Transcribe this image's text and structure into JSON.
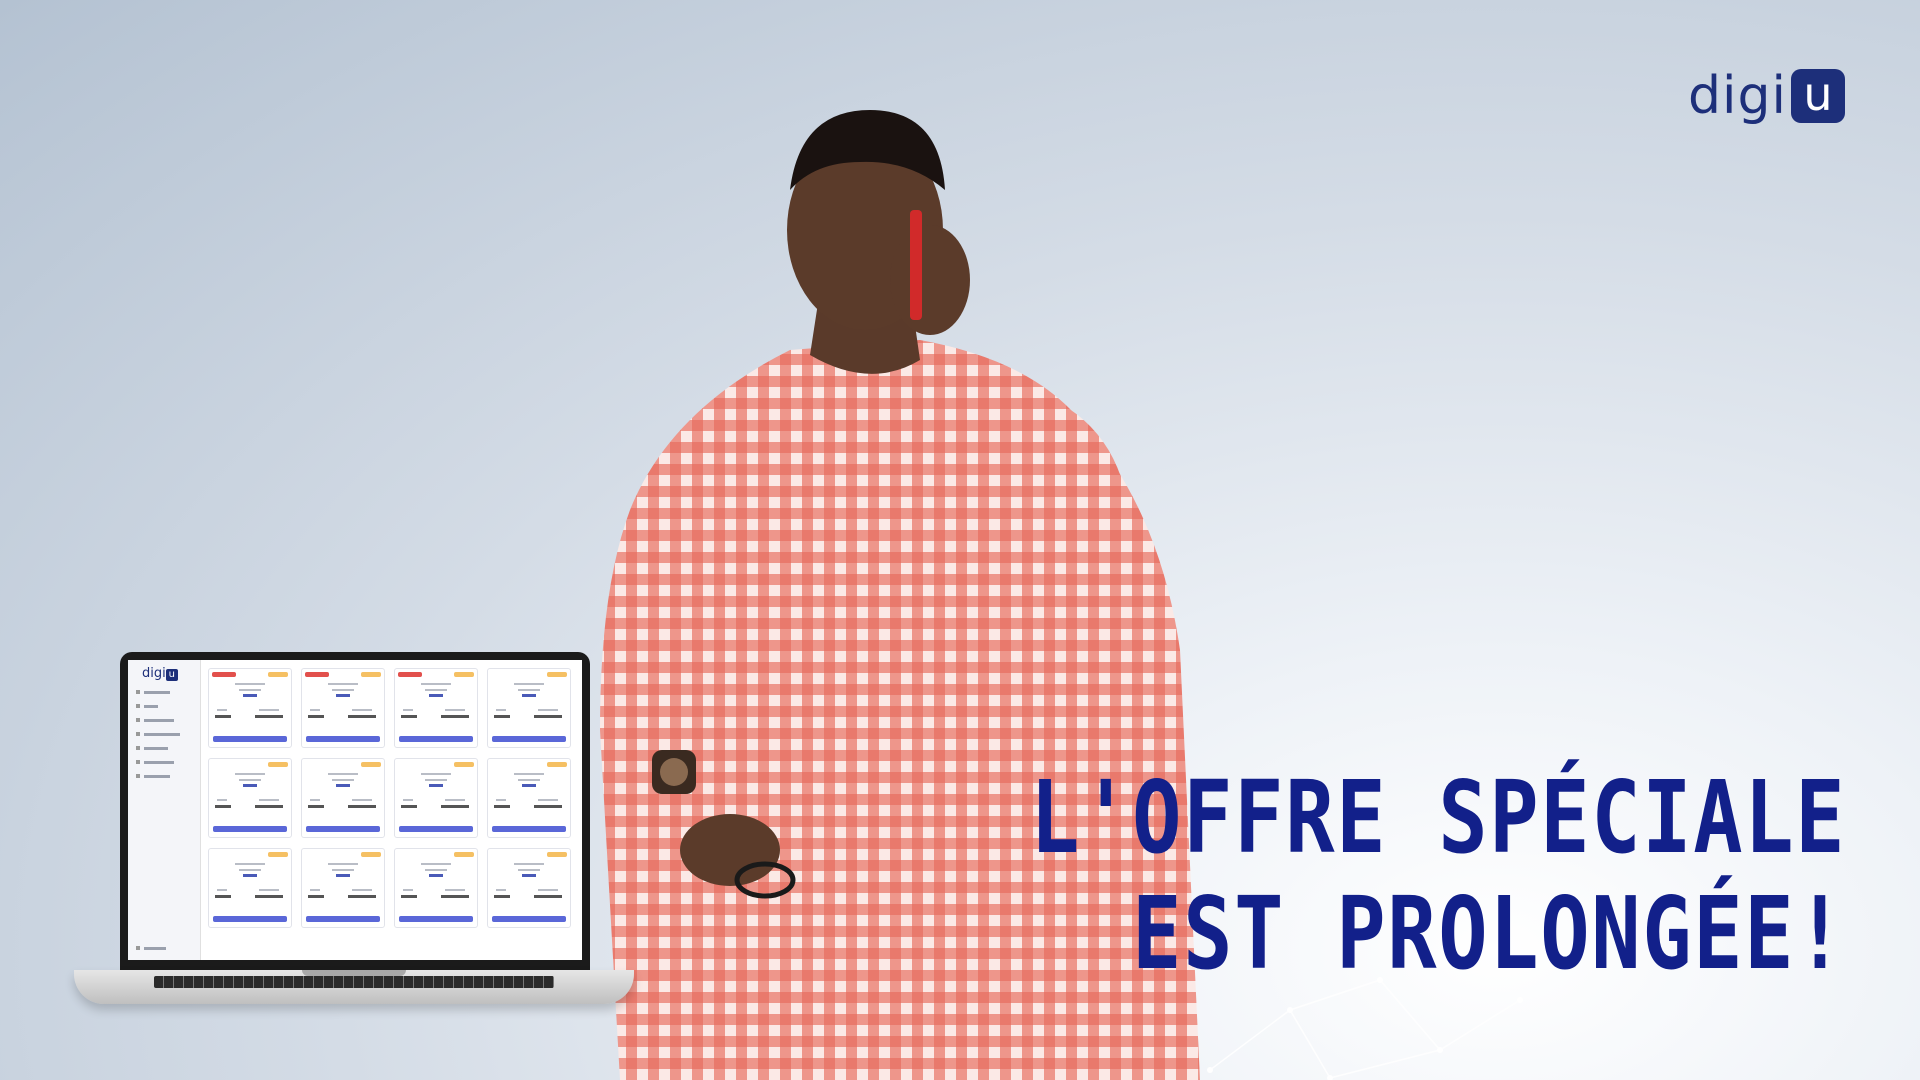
{
  "brand": {
    "logo_text": "digi",
    "logo_box_letter": "u",
    "color": "#1d2f7a"
  },
  "headline": {
    "line1": "L'OFFRE SPÉCIALE",
    "line2": "EST PROLONGÉE!",
    "color": "#12208a"
  },
  "laptop_screen": {
    "logo_text": "digi",
    "logo_box_letter": "u",
    "accent": "#5a67d8",
    "badge_color": "#f5c063"
  },
  "icons": [
    "network-lines-icon"
  ]
}
